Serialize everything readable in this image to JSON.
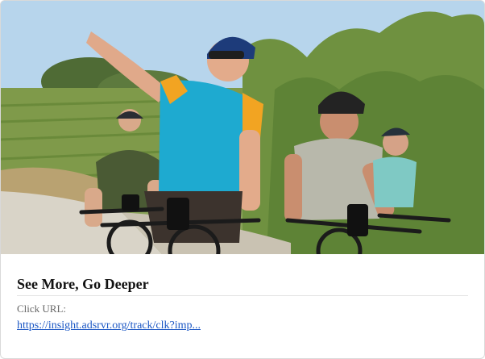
{
  "card": {
    "image_alt": "Group of cyclists riding e-bikes through a vineyard",
    "title": "See More, Go Deeper",
    "url_label": "Click URL:",
    "url_text": "https://insight.adsrvr.org/track/clk?imp..."
  },
  "colors": {
    "link": "#1a56c4",
    "title": "#111111",
    "label": "#666666",
    "jersey": "#1eaad0",
    "jersey_trim": "#f2a422"
  }
}
